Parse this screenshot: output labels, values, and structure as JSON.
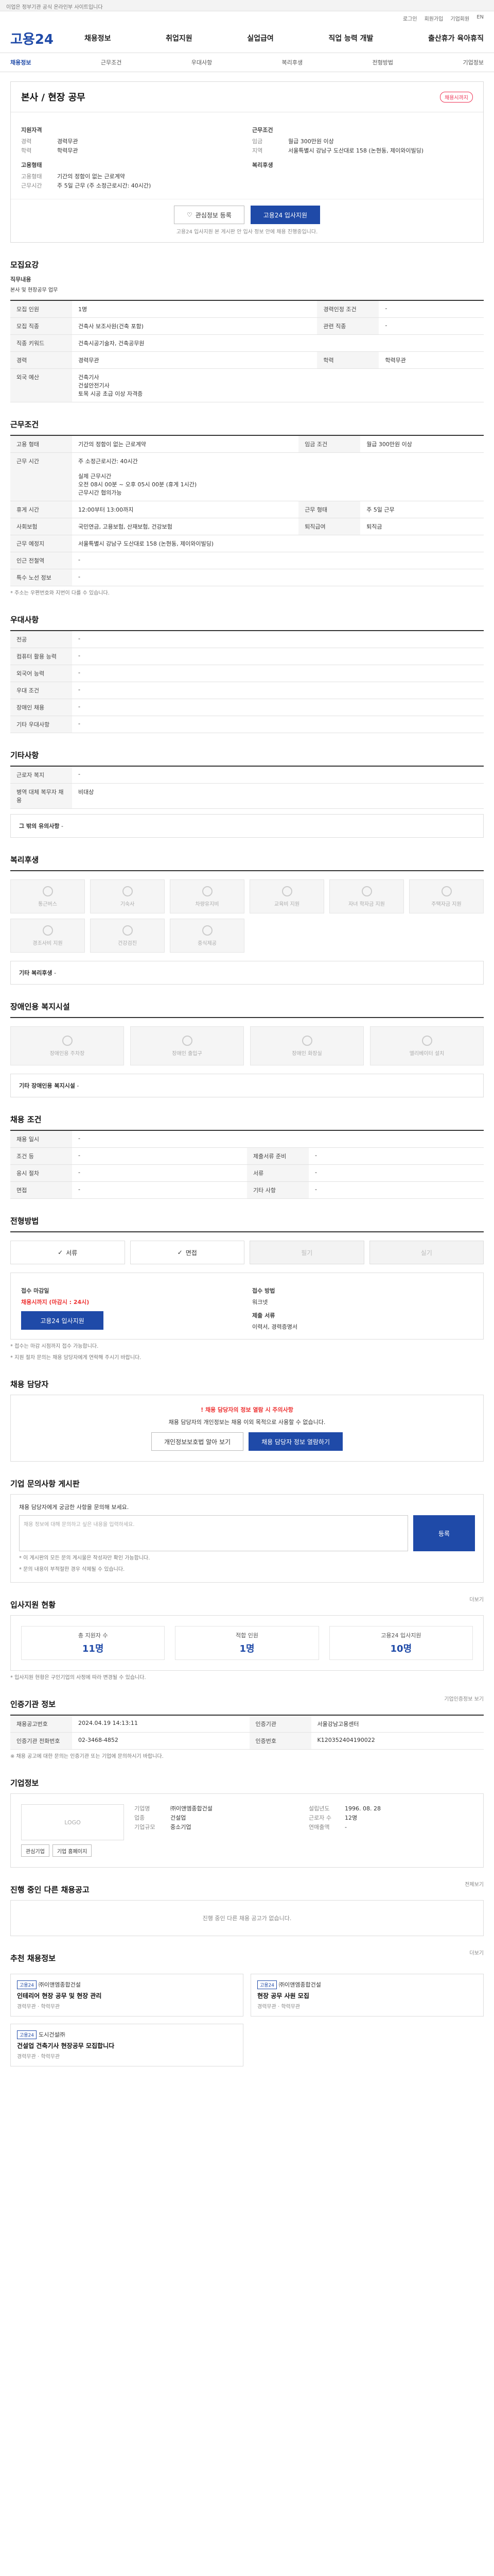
{
  "topbar": "이업은 정부기관 공식 온라인부 사이트입니다",
  "util": [
    "로그인",
    "회원가입",
    "기업회원",
    "EN"
  ],
  "logo": "고용24",
  "gnb": [
    "채용정보",
    "취업지원",
    "실업급여",
    "직업 능력 개발",
    "출산휴가 육아휴직"
  ],
  "subnav": [
    "채용정보",
    "근무조건",
    "우대사항",
    "복리후생",
    "전형방법",
    "기업정보"
  ],
  "job": {
    "title": "본사 / 현장 공무",
    "badge": "채용시까지",
    "company_h": "지원자격",
    "left": [
      {
        "k": "경력",
        "v": "경력무관"
      },
      {
        "k": "학력",
        "v": "학력무관"
      }
    ],
    "cond_h": "근무조건",
    "right": [
      {
        "k": "임금",
        "v": "월급 300만원 이상"
      },
      {
        "k": "지역",
        "v": "서울특별시 강남구 도산대로 158 (논현동, 제이와이빌딩)"
      }
    ],
    "type_h": "고용형태",
    "type": [
      {
        "k": "고용형태",
        "v": "기간의 정함이 없는 근로계약"
      },
      {
        "k": "근무시간",
        "v": "주 5일 근무 (주 소정근로시간: 40시간)"
      }
    ],
    "welfare_h": "복리후생",
    "save_btn": "관심정보 등록",
    "apply_btn": "고용24 입사지원",
    "notice": "고용24 입사지원 본 게시판 안 입사 정보 안에 채용 진행중입니다."
  },
  "s1": {
    "h": "모집요강",
    "sub": "직무내용",
    "desc": "본사 및 현장공무 업무",
    "rows": [
      {
        "k": "모집 인원",
        "v": "1명",
        "k2": "경력인정 조건",
        "v2": "-"
      },
      {
        "k": "모집 직종",
        "v": "건축사 보조사원(건축 포함)",
        "k2": "관련 직종",
        "v2": "-"
      },
      {
        "k": "직종 키워드",
        "v": "건축시공기술자, 건축공무원",
        "k2": "",
        "v2": ""
      },
      {
        "k": "경력",
        "v": "경력무관",
        "k2": "학력",
        "v2": "학력무관"
      },
      {
        "k": "외국 예산",
        "v": "건축기사\n건설안전기사\n토목 시공 초급 이상 자격증",
        "k2": "",
        "v2": ""
      }
    ]
  },
  "s2": {
    "h": "근무조건",
    "rows": [
      {
        "k": "고용 형태",
        "v": "기간의 정함이 없는 근로계약",
        "k2": "임금 조건",
        "v2": "월급 300만원 이상"
      },
      {
        "k": "근무 시간",
        "v": "주 소정근로시간: 40시간\n\n실제 근무시간\n오전 08시 00분 ~ 오후 05시 00분 (휴게 1시간)\n근무시간 협의가능",
        "k2": "",
        "v2": ""
      },
      {
        "k": "휴게 시간",
        "v": "12:00부터 13:00까지",
        "k2": "근무 형태",
        "v2": "주 5일 근무"
      },
      {
        "k": "사회보험",
        "v": "국민연금, 고용보험, 산재보험, 건강보험",
        "k2": "퇴직급여",
        "v2": "퇴직금"
      },
      {
        "k": "근무 예정지",
        "v": "서울특별시 강남구 도산대로 158 (논현동, 제이와이빌딩)",
        "k2": "",
        "v2": ""
      },
      {
        "k": "인근 전철역",
        "v": "-",
        "k2": "",
        "v2": ""
      },
      {
        "k": "특수 노선 정보",
        "v": "-",
        "k2": "",
        "v2": ""
      }
    ],
    "note": "* 주소는 우편번호와 지번이 다를 수 있습니다."
  },
  "s3": {
    "h": "우대사항",
    "rows": [
      {
        "k": "전공",
        "v": "-"
      },
      {
        "k": "컴퓨터 활용 능력",
        "v": "-"
      },
      {
        "k": "외국어 능력",
        "v": "-"
      },
      {
        "k": "우대 조건",
        "v": "-"
      },
      {
        "k": "장애인 채용",
        "v": "-"
      },
      {
        "k": "기타 우대사항",
        "v": "-"
      }
    ]
  },
  "s4": {
    "h": "기타사항",
    "rows": [
      {
        "k": "근로자 복지",
        "v": "-"
      },
      {
        "k": "병역 대체 복무자 채용",
        "v": "비대상"
      }
    ],
    "extra_k": "그 밖의 유의사항",
    "extra_v": "-"
  },
  "s5": {
    "h": "복리후생",
    "items": [
      "통근버스",
      "기숙사",
      "차량유지비",
      "교육비 지원",
      "자녀 학자금 지원",
      "주택자금 지원",
      "경조사비 지원",
      "건강검진",
      "중식제공"
    ],
    "other_k": "기타 복리후생",
    "other_v": "-"
  },
  "s6": {
    "h": "장애인용 복지시설",
    "items": [
      "장애인용 주차장",
      "장애인 출입구",
      "장애인 화장실",
      "엘리베이터 설치"
    ],
    "other_k": "기타 장애인용 복지시설",
    "other_v": "-"
  },
  "s7": {
    "h": "채용 조건",
    "rows": [
      {
        "k": "채용 일시",
        "v": "-",
        "k2": "",
        "v2": ""
      },
      {
        "k": "조건 등",
        "v": "-",
        "k2": "제출서류 준비",
        "v2": "-"
      },
      {
        "k": "응시 절차",
        "v": "-",
        "k2": "서류",
        "v2": "-"
      },
      {
        "k": "면접",
        "v": "-",
        "k2": "기타 사항",
        "v2": "-"
      }
    ]
  },
  "s8": {
    "h": "전형방법",
    "items": [
      "서류",
      "면접",
      "필기",
      "실기"
    ],
    "apply": {
      "h": "접수 마감일",
      "date": "채용시까지 (마감시 : 24시)",
      "btn": "고용24 입사지원",
      "doc_h": "접수 방법",
      "doc": "워크넷",
      "doc_h2": "제출 서류",
      "doc2": "이력서, 경력증명서"
    },
    "notes": [
      "* 접수는 마감 시점까지 접수 가능합니다.",
      "* 지원 절차 문의는 채용 담당자에게 연락해 주시기 바랍니다."
    ]
  },
  "s9": {
    "h": "채용 담당자",
    "warn": "! 채용 담당자의 정보 열람 시 주의사항",
    "msg": "채용 담당자의 개인정보는 채용 이외 목적으로 사용할 수 없습니다.",
    "b1": "개인정보보호법 알아 보기",
    "b2": "채용 담당자 정보 열람하기"
  },
  "s10": {
    "h": "기업 문의사항 게시판",
    "sub": "채용 담당자에게 궁금한 사항을 문의해 보세요.",
    "ph": "채용 정보에 대해 문의하고 싶은 내용을 입력하세요.",
    "btn": "등록",
    "list": [
      "* 이 게시판의 모든 문의 게시물은 작성자만 확인 가능합니다.",
      "* 문의 내용이 부적절한 경우 삭제될 수 있습니다."
    ]
  },
  "s11": {
    "h": "입사지원 현황",
    "more": "더보기",
    "stats": [
      {
        "k": "총 지원자 수",
        "v": "11명"
      },
      {
        "k": "적합 인원",
        "v": "1명"
      },
      {
        "k": "고용24 입사지원",
        "v": "10명"
      }
    ],
    "note": "* 입사지원 현황은 구인기업의 사정에 따라 변경될 수 있습니다."
  },
  "s12": {
    "h": "인증기관 정보",
    "more": "기업인증정보 보기",
    "rows": [
      {
        "k": "채용공고번호",
        "v": "2024.04.19 14:13:11",
        "k2": "인증기관",
        "v2": "서울강남고용센터"
      },
      {
        "k": "인증기관 전화번호",
        "v": "02-3468-4852",
        "k2": "인증번호",
        "v2": "K120352404190022"
      }
    ],
    "note": "※ 채용 공고에 대한 문의는 인증기관 또는 기업에 문의하시기 바랍니다."
  },
  "s13": {
    "h": "기업정보",
    "logo": "LOGO",
    "btns": [
      "관심기업",
      "기업 홈페이지"
    ],
    "rows": [
      {
        "k": "기업명",
        "v": "㈜이앤엠종합건설"
      },
      {
        "k": "업종",
        "v": "건설업"
      },
      {
        "k": "기업규모",
        "v": "중소기업"
      }
    ],
    "rows2": [
      {
        "k": "설립년도",
        "v": "1996. 08. 28"
      },
      {
        "k": "근로자 수",
        "v": "12명"
      },
      {
        "k": "연매출액",
        "v": "-"
      }
    ]
  },
  "s14": {
    "h": "진행 중인 다른 채용공고",
    "more": "전체보기",
    "empty": "진행 중인 다른 채용 공고가 없습니다."
  },
  "s15": {
    "h": "추천 채용정보",
    "more": "더보기",
    "cards": [
      {
        "tag": "고용24",
        "co": "㈜이앤엠종합건설",
        "t": "인테리어 현장 공무 및 현장 관리",
        "m": "경력무관 · 학력무관"
      },
      {
        "tag": "고용24",
        "co": "㈜이앤엠종합건설",
        "t": "현장 공무 사원 모집",
        "m": "경력무관 · 학력무관"
      },
      {
        "tag": "고용24",
        "co": "도시건설㈜",
        "t": "건설업 건축기사 현장공무 모집합니다",
        "m": "경력무관 · 학력무관"
      }
    ]
  }
}
